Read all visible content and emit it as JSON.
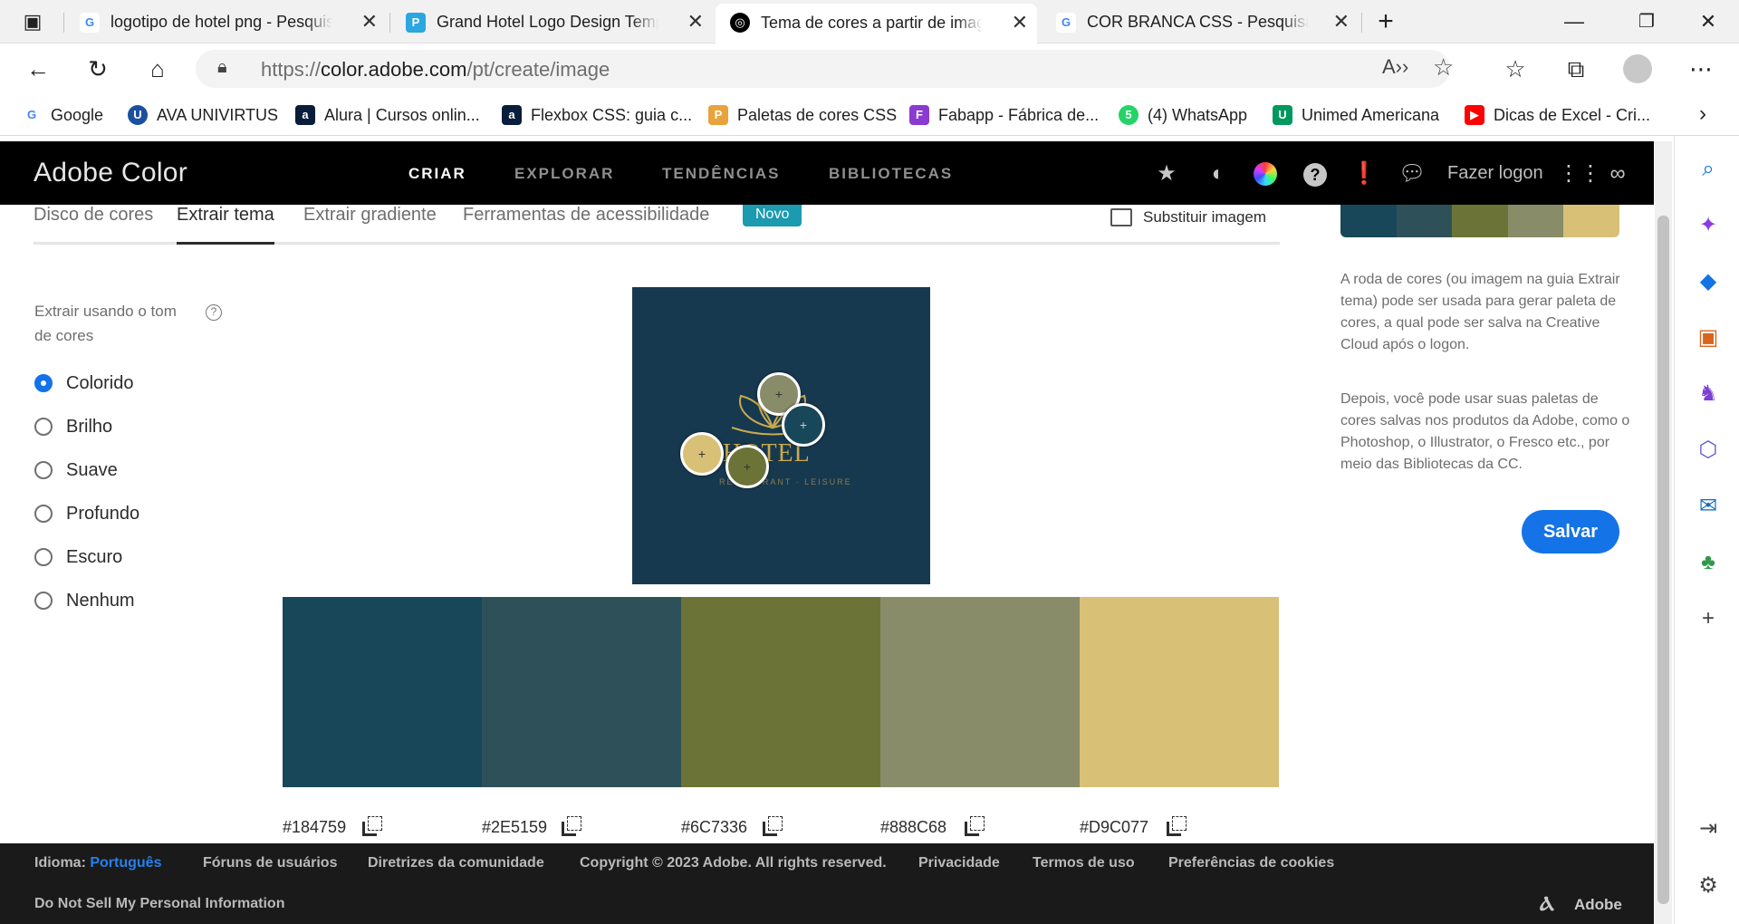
{
  "browser": {
    "tabs": [
      {
        "title": "logotipo de hotel png - Pesquisa Google",
        "favicon": "G",
        "color": "#4285f4"
      },
      {
        "title": "Grand Hotel Logo Design Template",
        "favicon": "P",
        "color": "#2aa6e0"
      },
      {
        "title": "Tema de cores a partir de imagem",
        "favicon": "C",
        "color": "#000000"
      },
      {
        "title": "COR BRANCA CSS - Pesquisa Google",
        "favicon": "G",
        "color": "#4285f4"
      }
    ],
    "url_prefix": "https://",
    "url_host": "color.adobe.com",
    "url_path": "/pt/create/image",
    "bookmarks": [
      {
        "label": "Google",
        "icon": "G",
        "color": "#4285f4"
      },
      {
        "label": "AVA UNIVIRTUS",
        "icon": "U",
        "color": "#1b4fa0"
      },
      {
        "label": "Alura | Cursos onlin...",
        "icon": "a",
        "color": "#0a1d3a"
      },
      {
        "label": "Flexbox CSS: guia c...",
        "icon": "a",
        "color": "#0a1d3a"
      },
      {
        "label": "Paletas de cores CSS",
        "icon": "P",
        "color": "#e8a33d"
      },
      {
        "label": "Fabapp - Fábrica de...",
        "icon": "F",
        "color": "#8a3ad1"
      },
      {
        "label": "(4) WhatsApp",
        "icon": "5",
        "color": "#25d366"
      },
      {
        "label": "Unimed Americana",
        "icon": "U",
        "color": "#00995d"
      },
      {
        "label": "Dicas de Excel - Cri...",
        "icon": "▶",
        "color": "#ff0000"
      }
    ]
  },
  "header": {
    "logo": "Adobe Color",
    "nav": [
      "CRIAR",
      "EXPLORAR",
      "TENDÊNCIAS",
      "BIBLIOTECAS"
    ],
    "login": "Fazer logon"
  },
  "subtabs": {
    "items": [
      "Disco de cores",
      "Extrair tema",
      "Extrair gradiente",
      "Ferramentas de acessibilidade"
    ],
    "new_badge": "Novo",
    "replace_image": "Substituir imagem"
  },
  "options": {
    "heading": "Extrair usando o tom de cores",
    "moods": [
      "Colorido",
      "Brilho",
      "Suave",
      "Profundo",
      "Escuro",
      "Nenhum"
    ],
    "selected": "Colorido"
  },
  "image": {
    "text": "HOTEL",
    "subtext": "RESTAURANT · LEISURE"
  },
  "palette": [
    {
      "hex": "#184759"
    },
    {
      "hex": "#2E5159"
    },
    {
      "hex": "#6C7336"
    },
    {
      "hex": "#888C68"
    },
    {
      "hex": "#D9C077"
    }
  ],
  "sidebar": {
    "para1": "A roda de cores (ou imagem na guia Extrair tema) pode ser usada para gerar paleta de cores, a qual pode ser salva na Creative Cloud após o logon.",
    "para2": "Depois, você pode usar suas paletas de cores salvas nos produtos da Adobe, como o Photoshop, o Illustrator, o Fresco etc., por meio das Bibliotecas da CC.",
    "save": "Salvar"
  },
  "footer": {
    "lang_label": "Idioma:",
    "lang_value": "Português",
    "links": [
      "Fóruns de usuários",
      "Diretrizes da comunidade",
      "Copyright © 2023 Adobe. All rights reserved.",
      "Privacidade",
      "Termos de uso",
      "Preferências de cookies"
    ],
    "dnsmpi": "Do Not Sell My Personal Information",
    "brand": "Adobe"
  }
}
